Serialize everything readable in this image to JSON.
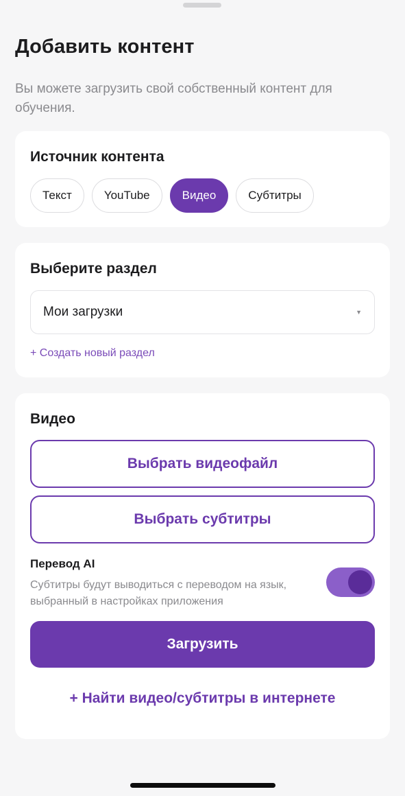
{
  "header": {
    "title": "Добавить контент",
    "subtitle": "Вы можете загрузить свой собственный контент для обучения."
  },
  "source": {
    "title": "Источник контента",
    "options": [
      "Текст",
      "YouTube",
      "Видео",
      "Субтитры"
    ],
    "selected": "Видео"
  },
  "section": {
    "title": "Выберите раздел",
    "selected_value": "Мои загрузки",
    "caret": "▼",
    "create_link": "+ Создать новый раздел"
  },
  "video": {
    "title": "Видео",
    "choose_file_label": "Выбрать видеофайл",
    "choose_subs_label": "Выбрать субтитры",
    "ai_title": "Перевод AI",
    "ai_description": "Субтитры будут выводиться с переводом на язык, выбранный в настройках приложения",
    "ai_enabled": true,
    "upload_label": "Загрузить",
    "find_link": "+ Найти видео/субтитры в интернете"
  },
  "colors": {
    "accent": "#6b3aad",
    "toggle_track": "#8b5fc9",
    "background": "#f6f6f7"
  }
}
